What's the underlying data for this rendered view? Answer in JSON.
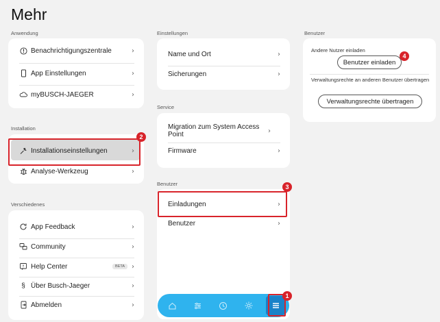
{
  "page": {
    "title": "Mehr"
  },
  "columns": {
    "left": {
      "anwendung_label": "Anwendung",
      "anwendung_items": [
        {
          "label": "Benachrichtigungszentrale",
          "icon": "notification-icon"
        },
        {
          "label": "App Einstellungen",
          "icon": "phone-icon"
        },
        {
          "label": "myBUSCH-JAEGER",
          "icon": "cloud-icon"
        }
      ],
      "installation_label": "Installation",
      "installation_items": [
        {
          "label": "Installationseinstellungen",
          "icon": "wrench-icon"
        },
        {
          "label": "Analyse-Werkzeug",
          "icon": "bug-icon"
        }
      ],
      "verschiedenes_label": "Verschiedenes",
      "verschiedenes_items": [
        {
          "label": "App Feedback",
          "icon": "refresh-icon"
        },
        {
          "label": "Community",
          "icon": "chat-icon"
        },
        {
          "label": "Help Center",
          "icon": "help-icon",
          "badge": "BETA"
        },
        {
          "label": "Über Busch-Jaeger",
          "icon": "paragraph-icon"
        },
        {
          "label": "Abmelden",
          "icon": "logout-icon"
        }
      ]
    },
    "middle": {
      "einstellungen_label": "Einstellungen",
      "einstellungen_items": [
        {
          "label": "Name und Ort"
        },
        {
          "label": "Sicherungen"
        }
      ],
      "service_label": "Service",
      "service_items": [
        {
          "label": "Migration zum System Access Point"
        },
        {
          "label": "Firmware"
        }
      ],
      "benutzer_label": "Benutzer",
      "benutzer_items": [
        {
          "label": "Einladungen"
        },
        {
          "label": "Benutzer"
        }
      ]
    },
    "right": {
      "benutzer_label": "Benutzer",
      "invite_text": "Andere Nutzer einladen",
      "invite_button": "Benutzer einladen",
      "admin_text": "Verwaltungsrechte an anderen Benutzer übertragen",
      "admin_button": "Verwaltungsrechte übertragen"
    }
  },
  "tabbar": {
    "tabs": [
      {
        "icon": "home-icon"
      },
      {
        "icon": "sliders-icon"
      },
      {
        "icon": "clock-icon"
      },
      {
        "icon": "gear-icon"
      },
      {
        "icon": "menu-icon",
        "active": true
      }
    ]
  },
  "annotations": {
    "markers": [
      "1",
      "2",
      "3",
      "4"
    ],
    "color": "#d8232a"
  },
  "colors": {
    "background": "#f2f2f2",
    "card": "#ffffff",
    "accent": "#2fb3ee",
    "active_tab": "#1a82c8"
  }
}
